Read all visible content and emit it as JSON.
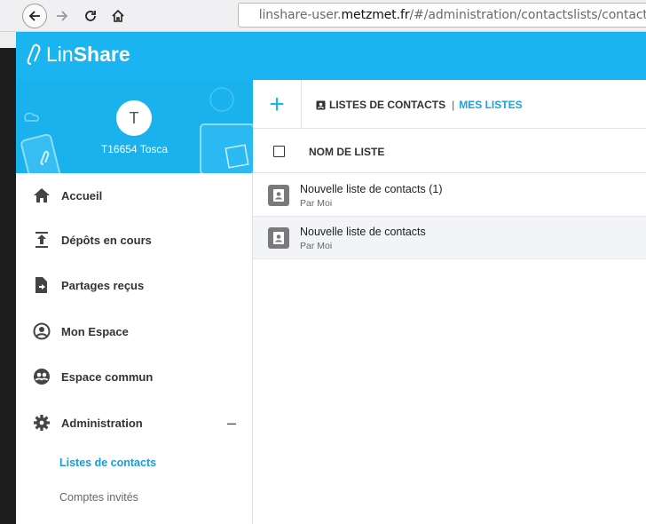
{
  "browser": {
    "url_prefix": "linshare-user.",
    "url_domain": "metzmet.fr",
    "url_path": "/#/administration/contactslists/contacts"
  },
  "app": {
    "logo_lin": "Lin",
    "logo_share": "Share"
  },
  "profile": {
    "initial": "T",
    "name": "T16654 Tosca"
  },
  "sidebar": {
    "items": [
      {
        "label": "Accueil",
        "icon": "home-icon"
      },
      {
        "label": "Dépôts en cours",
        "icon": "upload-icon"
      },
      {
        "label": "Partages reçus",
        "icon": "received-shares-icon"
      },
      {
        "label": "Mon Espace",
        "icon": "account-icon"
      },
      {
        "label": "Espace commun",
        "icon": "group-icon"
      },
      {
        "label": "Administration",
        "icon": "gear-icon",
        "toggle": "–"
      }
    ],
    "subitems": [
      {
        "label": "Listes de contacts",
        "active": true
      },
      {
        "label": "Comptes invités",
        "active": false
      }
    ]
  },
  "toolbar": {
    "add_label": "+",
    "tab_contacts": "LISTES DE CONTACTS",
    "tab_separator": "|",
    "tab_mine": "MES LISTES"
  },
  "list": {
    "column_header": "NOM DE LISTE",
    "rows": [
      {
        "title": "Nouvelle liste de contacts (1)",
        "owner": "Par Moi"
      },
      {
        "title": "Nouvelle liste de contacts",
        "owner": "Par Moi"
      }
    ]
  },
  "colors": {
    "brand": "#1ab5f0",
    "active_link": "#1a9bd8"
  }
}
